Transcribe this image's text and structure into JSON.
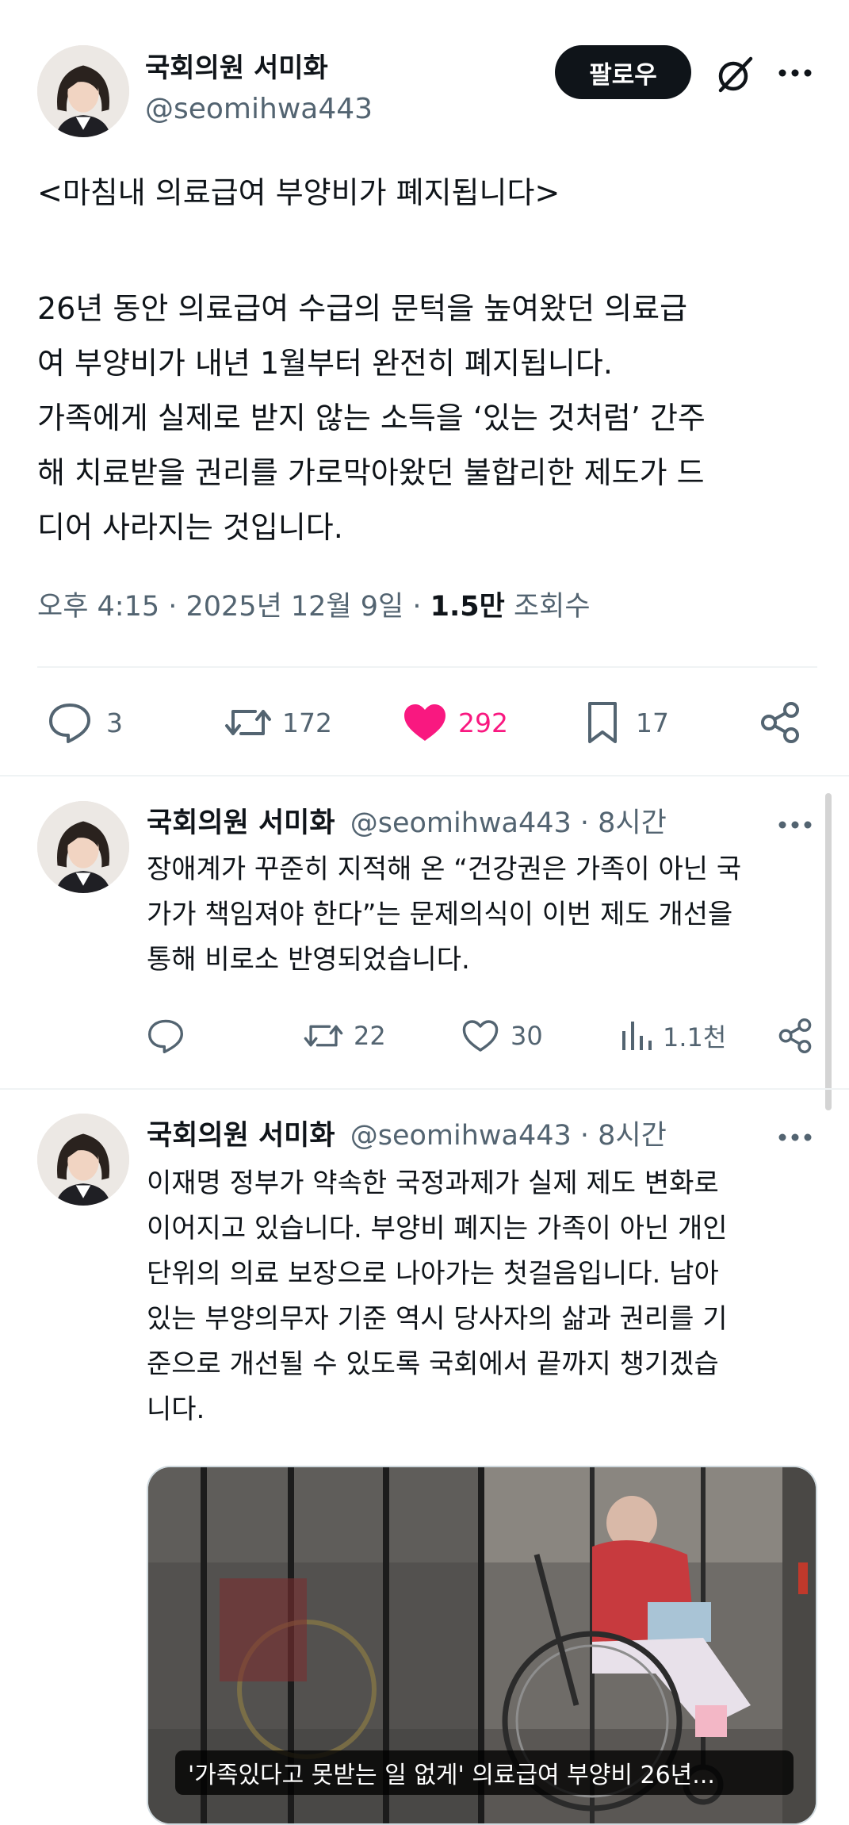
{
  "main_tweet": {
    "author_name": "국회의원 서미화",
    "handle": "@seomihwa443",
    "follow_label": "팔로우",
    "title_line": "<마침내 의료급여 부양비가 폐지됩니다>",
    "body": "26년 동안 의료급여 수급의 문턱을 높여왔던 의료급\n여 부양비가 내년 1월부터 완전히 폐지됩니다.\n가족에게 실제로 받지 않는 소득을 ‘있는 것처럼’ 간주\n해 치료받을 권리를 가로막아왔던 불합리한 제도가 드\n디어 사라지는 것입니다.",
    "time": "오후 4:15 · 2025년 12월 9일 · ",
    "views_count": "1.5만",
    "views_label": " 조회수",
    "replies": "3",
    "retweets": "172",
    "likes": "292",
    "bookmarks": "17",
    "like_color": "#f91880"
  },
  "replies": [
    {
      "author_name": "국회의원 서미화",
      "handle_time": "@seomihwa443 · 8시간",
      "body": "장애계가 꾸준히 지적해 온 “건강권은 가족이 아닌 국\n가가 책임져야 한다”는 문제의식이 이번 제도 개선을\n통해 비로소 반영되었습니다.",
      "retweets": "22",
      "likes": "30",
      "views": "1.1천"
    },
    {
      "author_name": "국회의원 서미화",
      "handle_time": "@seomihwa443 · 8시간",
      "body": "이재명 정부가 약속한 국정과제가 실제 제도 변화로\n이어지고 있습니다. 부양비 폐지는 가족이 아닌 개인\n단위의 의료 보장으로 나아가는 첫걸음입니다. 남아\n있는 부양의무자 기준 역시 당사자의 삶과 권리를 기\n준으로 개선될 수 있도록 국회에서 끝까지 챙기겠습\n니다.",
      "media_caption": "'가족있다고 못받는 일 없게' 의료급여 부양비 26년..."
    }
  ],
  "icons": {
    "more": "more-icon",
    "grok": "grok-icon",
    "reply": "reply-icon",
    "retweet": "retweet-icon",
    "like": "heart-icon",
    "bookmark": "bookmark-icon",
    "share": "share-icon",
    "views": "views-icon"
  }
}
